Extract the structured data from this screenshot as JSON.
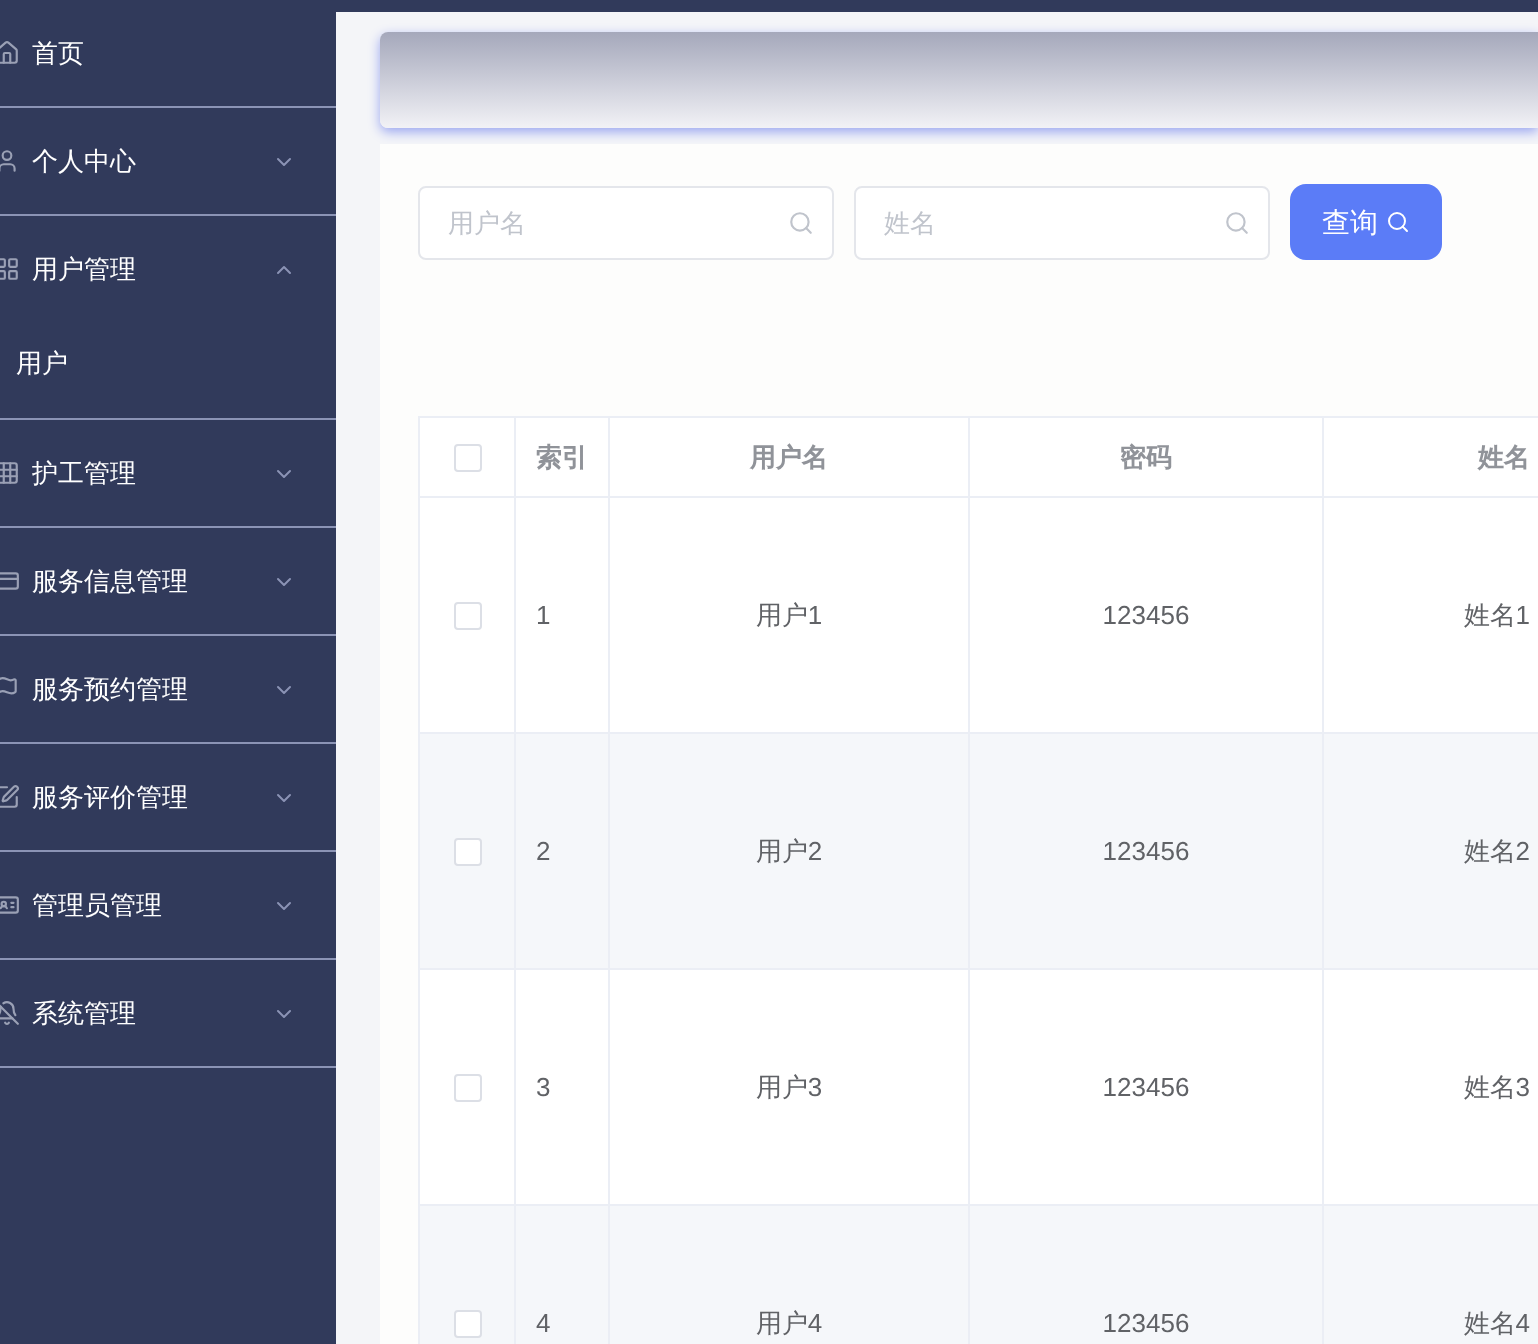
{
  "sidebar": {
    "items": [
      {
        "label": "首页",
        "kind": "link"
      },
      {
        "label": "个人中心",
        "kind": "menu",
        "expanded": false
      },
      {
        "label": "用户管理",
        "kind": "menu",
        "expanded": true,
        "children": [
          {
            "label": "用户"
          }
        ]
      },
      {
        "label": "护工管理",
        "kind": "menu",
        "expanded": false
      },
      {
        "label": "服务信息管理",
        "kind": "menu",
        "expanded": false
      },
      {
        "label": "服务预约管理",
        "kind": "menu",
        "expanded": false
      },
      {
        "label": "服务评价管理",
        "kind": "menu",
        "expanded": false
      },
      {
        "label": "管理员管理",
        "kind": "menu",
        "expanded": false
      },
      {
        "label": "系统管理",
        "kind": "menu",
        "expanded": false
      }
    ]
  },
  "search": {
    "fields": [
      {
        "placeholder": "用户名"
      },
      {
        "placeholder": "姓名"
      }
    ],
    "button": "查询"
  },
  "table": {
    "select_all": {
      "checked": false
    },
    "columns": [
      "索引",
      "用户名",
      "密码",
      "姓名"
    ],
    "rows": [
      {
        "checked": false,
        "cells": [
          "1",
          "用户1",
          "123456",
          "姓名1"
        ]
      },
      {
        "checked": false,
        "cells": [
          "2",
          "用户2",
          "123456",
          "姓名2"
        ]
      },
      {
        "checked": false,
        "cells": [
          "3",
          "用户3",
          "123456",
          "姓名3"
        ]
      },
      {
        "checked": false,
        "cells": [
          "4",
          "用户4",
          "123456",
          "姓名4"
        ]
      }
    ]
  }
}
